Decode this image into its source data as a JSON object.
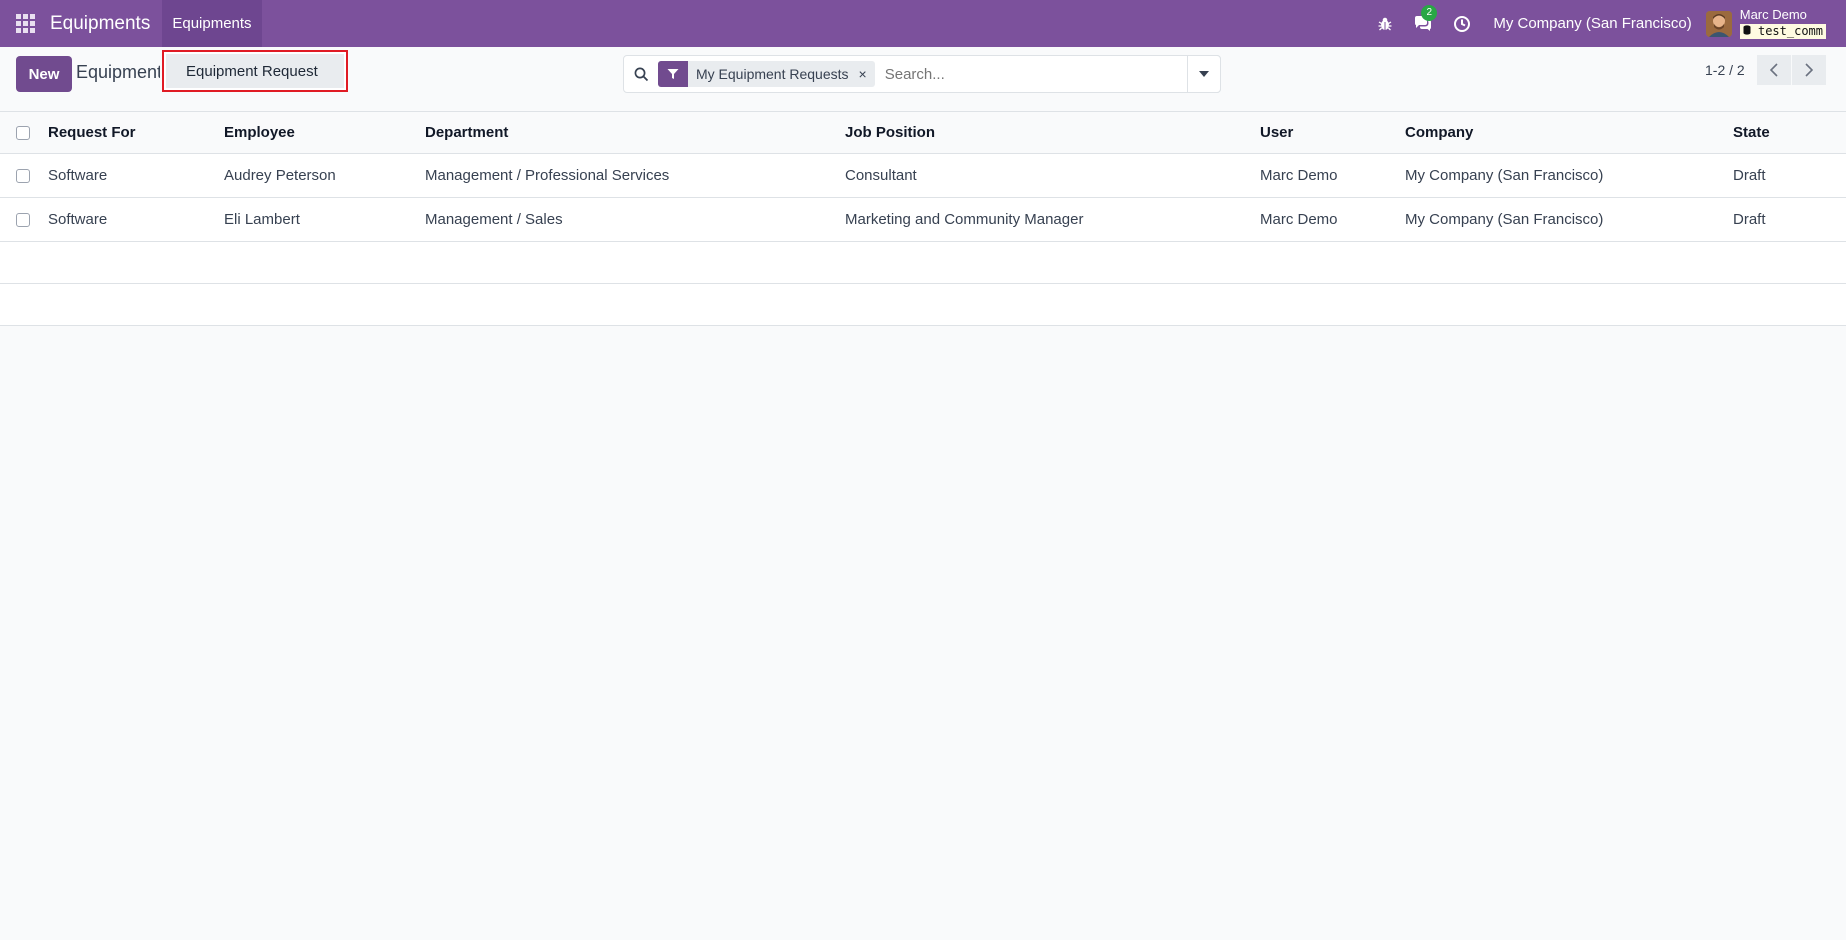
{
  "navbar": {
    "app_title": "Equipments",
    "menu_equipments": "Equipments",
    "messages_badge": "2",
    "company": "My Company (San Francisco)",
    "user_name": "Marc Demo",
    "database": "test_comm"
  },
  "control_panel": {
    "new_label": "New",
    "breadcrumb": "Equipments",
    "dropdown_item": "Equipment Request",
    "facet_label": "My Equipment Requests",
    "facet_remove": "×",
    "search_placeholder": "Search...",
    "pager": "1-2 / 2"
  },
  "table": {
    "columns": [
      "Request For",
      "Employee",
      "Department",
      "Job Position",
      "User",
      "Company",
      "State"
    ],
    "rows": [
      [
        "Software",
        "Audrey Peterson",
        "Management / Professional Services",
        "Consultant",
        "Marc Demo",
        "My Company (San Francisco)",
        "Draft"
      ],
      [
        "Software",
        "Eli Lambert",
        "Management / Sales",
        "Marketing and Community Manager",
        "Marc Demo",
        "My Company (San Francisco)",
        "Draft"
      ]
    ]
  },
  "colors": {
    "navbar": "#7c519c",
    "primary": "#714b8f",
    "highlight_border": "#e01b24",
    "badge": "#28a745"
  }
}
